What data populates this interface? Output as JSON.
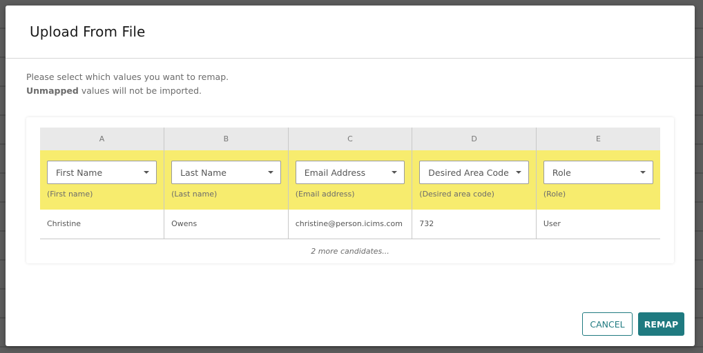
{
  "dialog": {
    "title": "Upload From File",
    "instruction_line1": "Please select which values you want to remap.",
    "instruction_bold": "Unmapped",
    "instruction_line2_rest": " values will not be imported."
  },
  "table": {
    "columns": [
      {
        "letter": "A",
        "mapped_value": "First Name",
        "original_header": "(First name)",
        "sample": "Christine"
      },
      {
        "letter": "B",
        "mapped_value": "Last Name",
        "original_header": "(Last name)",
        "sample": "Owens"
      },
      {
        "letter": "C",
        "mapped_value": "Email Address",
        "original_header": "(Email address)",
        "sample": "christine@person.icims.com"
      },
      {
        "letter": "D",
        "mapped_value": "Desired Area Code",
        "original_header": "(Desired area code)",
        "sample": "732"
      },
      {
        "letter": "E",
        "mapped_value": "Role",
        "original_header": "(Role)",
        "sample": "User"
      }
    ],
    "more_text": "2 more candidates..."
  },
  "footer": {
    "cancel_label": "CANCEL",
    "remap_label": "REMAP"
  },
  "colors": {
    "accent": "#1f7a80",
    "mapping_row": "#f7ec6e",
    "header_row": "#e9e9e9"
  }
}
